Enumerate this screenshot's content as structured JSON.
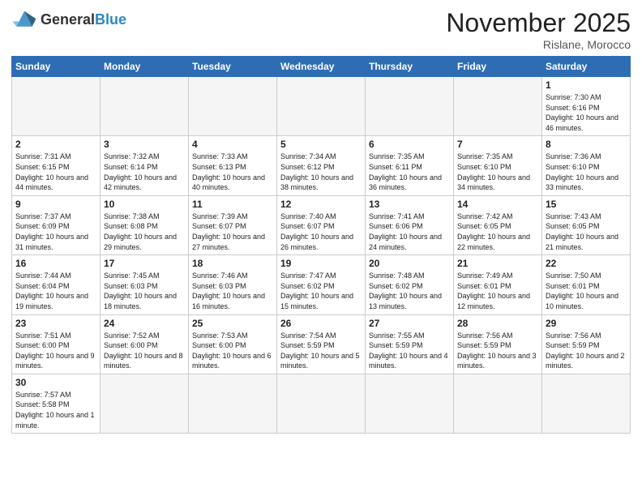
{
  "header": {
    "logo_general": "General",
    "logo_blue": "Blue",
    "month_title": "November 2025",
    "location": "Rislane, Morocco"
  },
  "days_of_week": [
    "Sunday",
    "Monday",
    "Tuesday",
    "Wednesday",
    "Thursday",
    "Friday",
    "Saturday"
  ],
  "weeks": [
    [
      {
        "num": "",
        "info": ""
      },
      {
        "num": "",
        "info": ""
      },
      {
        "num": "",
        "info": ""
      },
      {
        "num": "",
        "info": ""
      },
      {
        "num": "",
        "info": ""
      },
      {
        "num": "",
        "info": ""
      },
      {
        "num": "1",
        "info": "Sunrise: 7:30 AM\nSunset: 6:16 PM\nDaylight: 10 hours and 46 minutes."
      }
    ],
    [
      {
        "num": "2",
        "info": "Sunrise: 7:31 AM\nSunset: 6:15 PM\nDaylight: 10 hours and 44 minutes."
      },
      {
        "num": "3",
        "info": "Sunrise: 7:32 AM\nSunset: 6:14 PM\nDaylight: 10 hours and 42 minutes."
      },
      {
        "num": "4",
        "info": "Sunrise: 7:33 AM\nSunset: 6:13 PM\nDaylight: 10 hours and 40 minutes."
      },
      {
        "num": "5",
        "info": "Sunrise: 7:34 AM\nSunset: 6:12 PM\nDaylight: 10 hours and 38 minutes."
      },
      {
        "num": "6",
        "info": "Sunrise: 7:35 AM\nSunset: 6:11 PM\nDaylight: 10 hours and 36 minutes."
      },
      {
        "num": "7",
        "info": "Sunrise: 7:35 AM\nSunset: 6:10 PM\nDaylight: 10 hours and 34 minutes."
      },
      {
        "num": "8",
        "info": "Sunrise: 7:36 AM\nSunset: 6:10 PM\nDaylight: 10 hours and 33 minutes."
      }
    ],
    [
      {
        "num": "9",
        "info": "Sunrise: 7:37 AM\nSunset: 6:09 PM\nDaylight: 10 hours and 31 minutes."
      },
      {
        "num": "10",
        "info": "Sunrise: 7:38 AM\nSunset: 6:08 PM\nDaylight: 10 hours and 29 minutes."
      },
      {
        "num": "11",
        "info": "Sunrise: 7:39 AM\nSunset: 6:07 PM\nDaylight: 10 hours and 27 minutes."
      },
      {
        "num": "12",
        "info": "Sunrise: 7:40 AM\nSunset: 6:07 PM\nDaylight: 10 hours and 26 minutes."
      },
      {
        "num": "13",
        "info": "Sunrise: 7:41 AM\nSunset: 6:06 PM\nDaylight: 10 hours and 24 minutes."
      },
      {
        "num": "14",
        "info": "Sunrise: 7:42 AM\nSunset: 6:05 PM\nDaylight: 10 hours and 22 minutes."
      },
      {
        "num": "15",
        "info": "Sunrise: 7:43 AM\nSunset: 6:05 PM\nDaylight: 10 hours and 21 minutes."
      }
    ],
    [
      {
        "num": "16",
        "info": "Sunrise: 7:44 AM\nSunset: 6:04 PM\nDaylight: 10 hours and 19 minutes."
      },
      {
        "num": "17",
        "info": "Sunrise: 7:45 AM\nSunset: 6:03 PM\nDaylight: 10 hours and 18 minutes."
      },
      {
        "num": "18",
        "info": "Sunrise: 7:46 AM\nSunset: 6:03 PM\nDaylight: 10 hours and 16 minutes."
      },
      {
        "num": "19",
        "info": "Sunrise: 7:47 AM\nSunset: 6:02 PM\nDaylight: 10 hours and 15 minutes."
      },
      {
        "num": "20",
        "info": "Sunrise: 7:48 AM\nSunset: 6:02 PM\nDaylight: 10 hours and 13 minutes."
      },
      {
        "num": "21",
        "info": "Sunrise: 7:49 AM\nSunset: 6:01 PM\nDaylight: 10 hours and 12 minutes."
      },
      {
        "num": "22",
        "info": "Sunrise: 7:50 AM\nSunset: 6:01 PM\nDaylight: 10 hours and 10 minutes."
      }
    ],
    [
      {
        "num": "23",
        "info": "Sunrise: 7:51 AM\nSunset: 6:00 PM\nDaylight: 10 hours and 9 minutes."
      },
      {
        "num": "24",
        "info": "Sunrise: 7:52 AM\nSunset: 6:00 PM\nDaylight: 10 hours and 8 minutes."
      },
      {
        "num": "25",
        "info": "Sunrise: 7:53 AM\nSunset: 6:00 PM\nDaylight: 10 hours and 6 minutes."
      },
      {
        "num": "26",
        "info": "Sunrise: 7:54 AM\nSunset: 5:59 PM\nDaylight: 10 hours and 5 minutes."
      },
      {
        "num": "27",
        "info": "Sunrise: 7:55 AM\nSunset: 5:59 PM\nDaylight: 10 hours and 4 minutes."
      },
      {
        "num": "28",
        "info": "Sunrise: 7:56 AM\nSunset: 5:59 PM\nDaylight: 10 hours and 3 minutes."
      },
      {
        "num": "29",
        "info": "Sunrise: 7:56 AM\nSunset: 5:59 PM\nDaylight: 10 hours and 2 minutes."
      }
    ],
    [
      {
        "num": "30",
        "info": "Sunrise: 7:57 AM\nSunset: 5:58 PM\nDaylight: 10 hours and 1 minute."
      },
      {
        "num": "",
        "info": ""
      },
      {
        "num": "",
        "info": ""
      },
      {
        "num": "",
        "info": ""
      },
      {
        "num": "",
        "info": ""
      },
      {
        "num": "",
        "info": ""
      },
      {
        "num": "",
        "info": ""
      }
    ]
  ]
}
